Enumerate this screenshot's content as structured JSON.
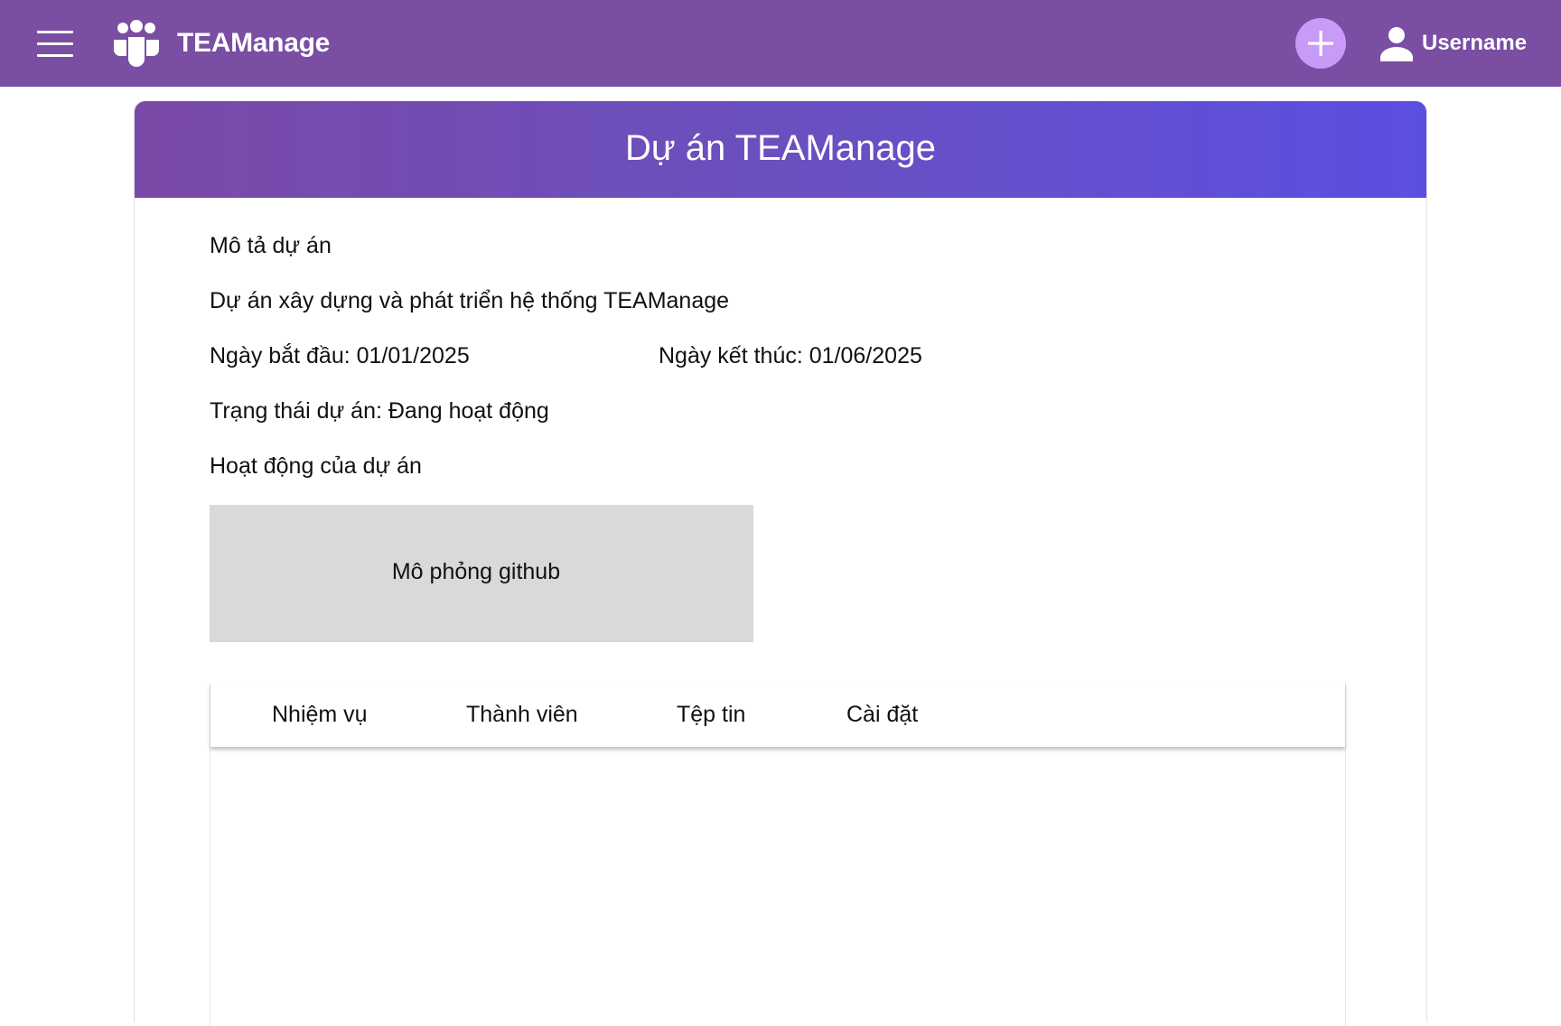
{
  "header": {
    "app_title": "TEAManage",
    "username": "Username",
    "menu_icon": "hamburger-menu-icon",
    "logo_icon": "team-icon",
    "add_icon": "plus-icon",
    "user_icon": "user-icon",
    "bar_color": "#794ea3",
    "add_button_color": "#c79bf7"
  },
  "project": {
    "title": "Dự án TEAManage",
    "description_label": "Mô tả dự án",
    "description": "Dự án xây dựng và phát triển hệ thống TEAManage",
    "start_date": "Ngày bắt đầu: 01/01/2025",
    "end_date": "Ngày kết thúc: 01/06/2025",
    "status": "Trạng thái dự án: Đang hoạt động",
    "activity_label": "Hoạt động của dự án",
    "github_placeholder": "Mô phỏng github",
    "header_gradient": [
      "#7a4aa8",
      "#5b4fe2"
    ]
  },
  "tabs": [
    {
      "label": "Nhiệm vụ"
    },
    {
      "label": "Thành viên"
    },
    {
      "label": "Tệp tin"
    },
    {
      "label": "Cài đặt"
    }
  ]
}
